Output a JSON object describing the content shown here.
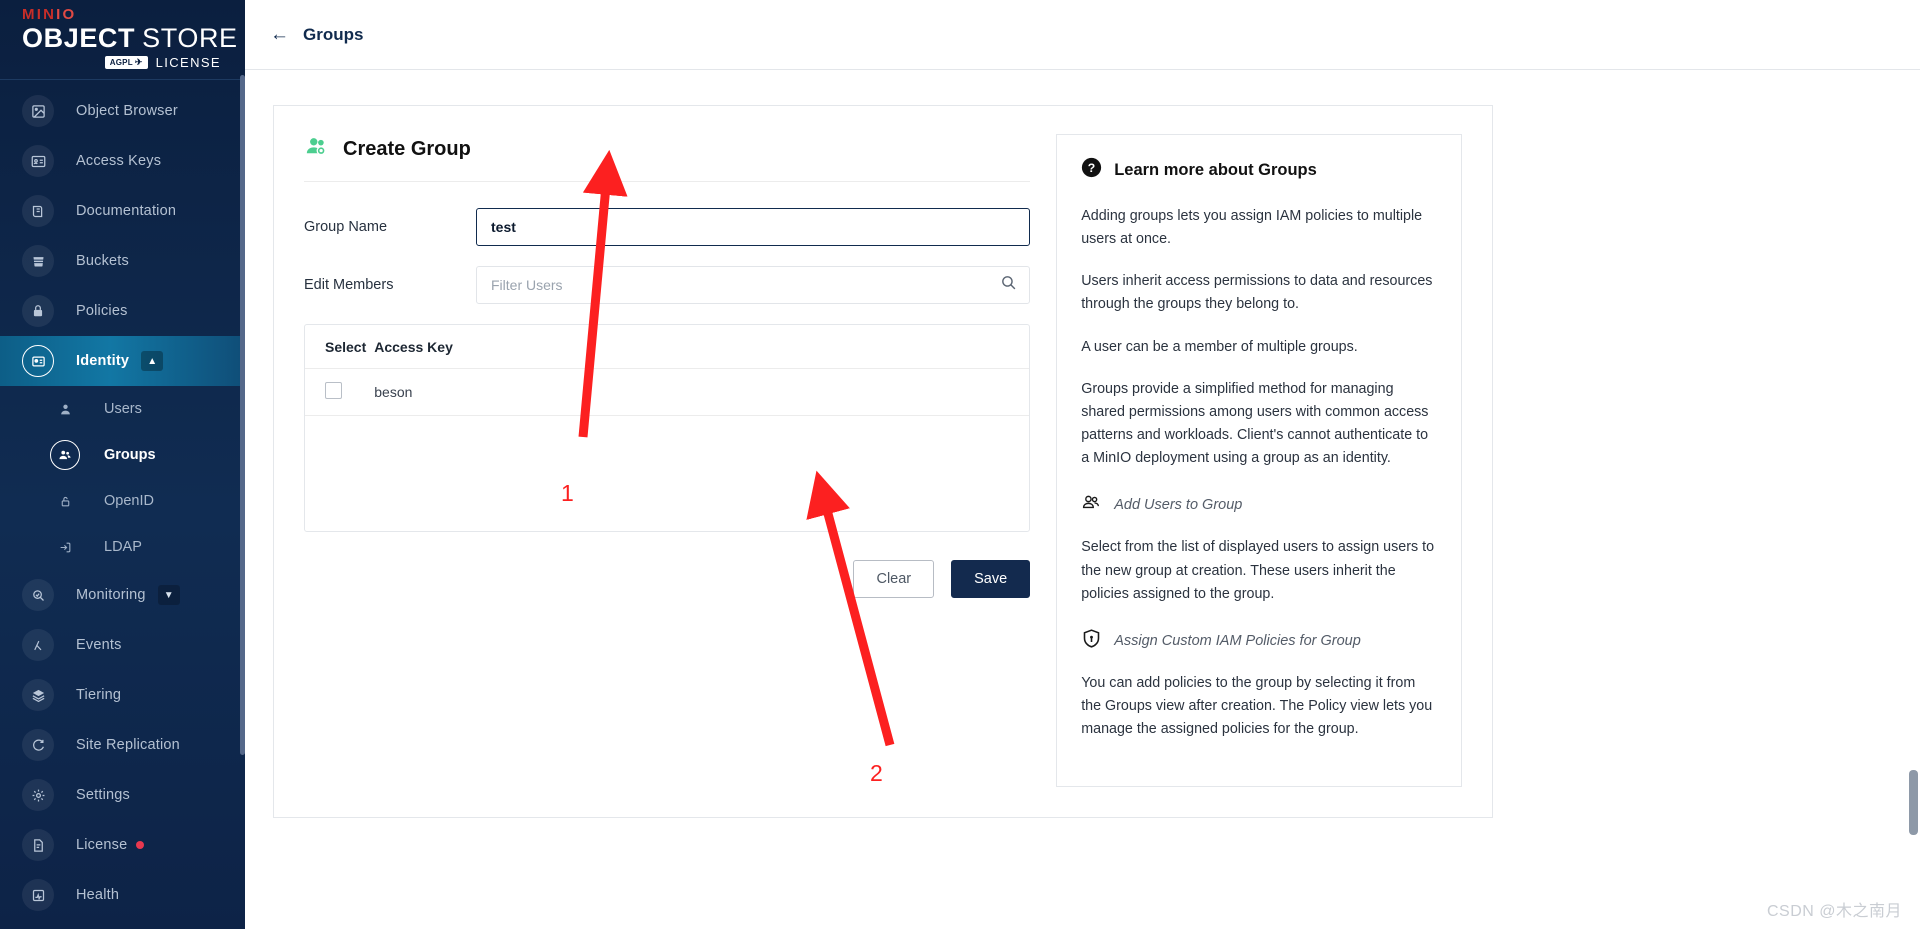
{
  "brand": {
    "minio": "MIN",
    "minio_io": "IO",
    "object": "OBJECT",
    "store": "STORE",
    "agpl": "AGPL",
    "license": "LICENSE"
  },
  "sidebar": {
    "items": [
      {
        "label": "Object Browser",
        "icon": "image-icon",
        "active": false
      },
      {
        "label": "Access Keys",
        "icon": "id-card-icon",
        "active": false
      },
      {
        "label": "Documentation",
        "icon": "book-icon",
        "active": false
      },
      {
        "label": "Buckets",
        "icon": "bucket-icon",
        "active": false
      },
      {
        "label": "Policies",
        "icon": "lock-icon",
        "active": false
      },
      {
        "label": "Identity",
        "icon": "identity-icon",
        "active": true,
        "expanded": true
      }
    ],
    "identity_children": [
      {
        "label": "Users",
        "icon": "user-icon",
        "active": false
      },
      {
        "label": "Groups",
        "icon": "groups-icon",
        "active": true
      },
      {
        "label": "OpenID",
        "icon": "padlock-icon",
        "active": false
      },
      {
        "label": "LDAP",
        "icon": "login-icon",
        "active": false
      }
    ],
    "items_after": [
      {
        "label": "Monitoring",
        "icon": "monitoring-icon",
        "collapsed": true
      },
      {
        "label": "Events",
        "icon": "lambda-icon"
      },
      {
        "label": "Tiering",
        "icon": "layers-icon"
      },
      {
        "label": "Site Replication",
        "icon": "sync-icon"
      },
      {
        "label": "Settings",
        "icon": "gear-icon"
      },
      {
        "label": "License",
        "icon": "license-icon",
        "badge": true
      },
      {
        "label": "Health",
        "icon": "health-icon"
      }
    ]
  },
  "topbar": {
    "back_label": "Groups",
    "back_icon": "arrow-left-icon"
  },
  "form": {
    "title": "Create Group",
    "title_icon": "groups-green-icon",
    "group_name_label": "Group Name",
    "group_name_value": "test",
    "edit_members_label": "Edit Members",
    "filter_placeholder": "Filter Users",
    "filter_value": "",
    "search_icon": "search-icon",
    "table": {
      "columns": [
        "Select",
        "Access Key"
      ],
      "rows": [
        {
          "selected": false,
          "access_key": "beson"
        }
      ]
    },
    "buttons": {
      "clear": "Clear",
      "save": "Save"
    }
  },
  "help": {
    "icon": "question-circle-icon",
    "title": "Learn more about Groups",
    "paragraphs": [
      "Adding groups lets you assign IAM policies to multiple users at once.",
      "Users inherit access permissions to data and resources through the groups they belong to.",
      "A user can be a member of multiple groups.",
      "Groups provide a simplified method for managing shared permissions among users with common access patterns and workloads. Client's cannot authenticate to a MinIO deployment using a group as an identity."
    ],
    "subsections": [
      {
        "icon": "add-users-icon",
        "label": "Add Users to Group",
        "body": "Select from the list of displayed users to assign users to the new group at creation. These users inherit the policies assigned to the group."
      },
      {
        "icon": "shield-icon",
        "label": "Assign Custom IAM Policies for Group",
        "body": "You can add policies to the group by selecting it from the Groups view after creation. The Policy view lets you manage the assigned policies for the group."
      }
    ]
  },
  "annotations": {
    "marker_one": "1",
    "marker_two": "2",
    "arrow_color": "#fc2020"
  },
  "watermark": "CSDN @木之南月",
  "colors": {
    "sidebar_bg": "#0d2347",
    "active_nav": "#1277a4",
    "accent_green": "#4cce8f",
    "save_button": "#132a4e",
    "brand_red": "#c72e29",
    "license_dot": "#e8384f"
  }
}
